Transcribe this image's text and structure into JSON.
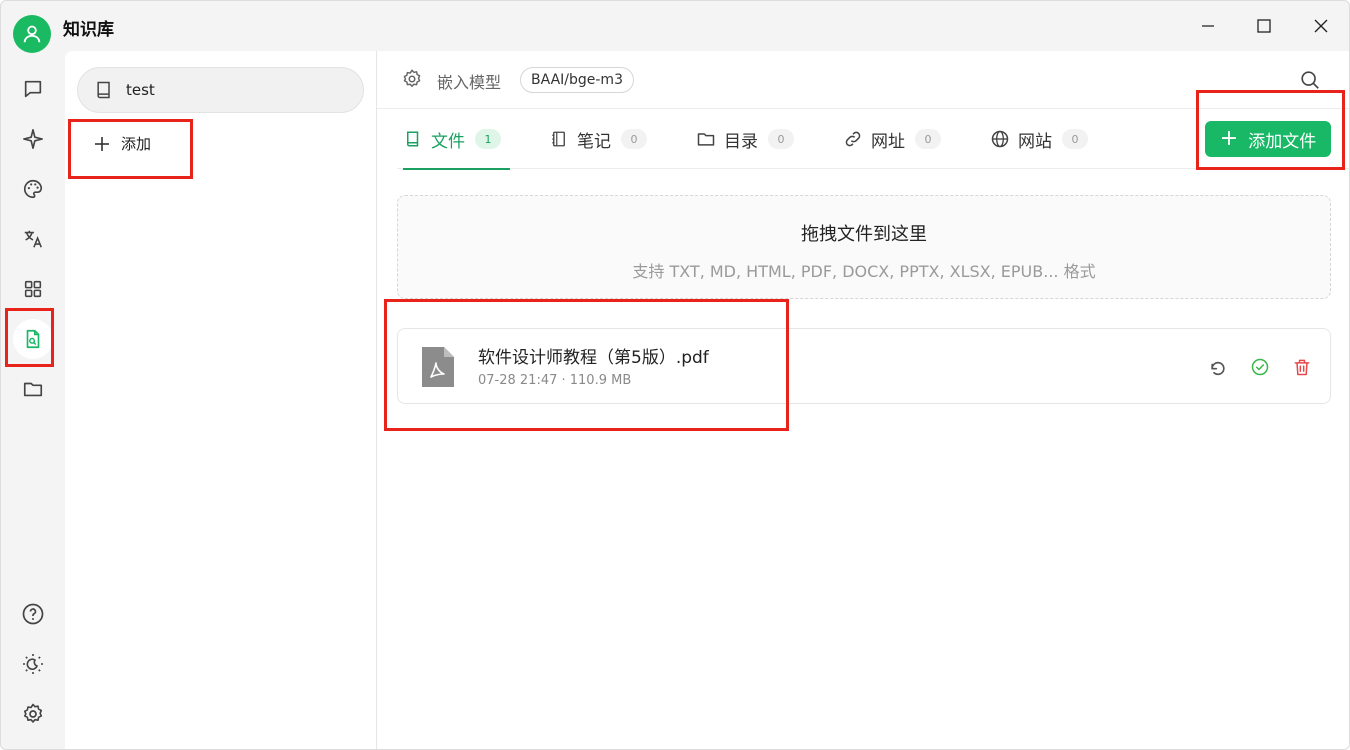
{
  "app": {
    "title": "知识库"
  },
  "window_controls": {
    "minimize": "minimize",
    "maximize": "maximize",
    "close": "close"
  },
  "rail": {
    "items": [
      {
        "icon": "chat-icon"
      },
      {
        "icon": "sparkle-icon"
      },
      {
        "icon": "palette-icon"
      },
      {
        "icon": "translate-icon"
      },
      {
        "icon": "apps-grid-icon"
      },
      {
        "icon": "knowledge-base-icon",
        "active": true
      },
      {
        "icon": "folder-icon"
      }
    ],
    "bottom": [
      {
        "icon": "help-icon"
      },
      {
        "icon": "theme-icon"
      },
      {
        "icon": "settings-icon"
      }
    ]
  },
  "kb_list": {
    "items": [
      {
        "label": "test"
      }
    ],
    "add_label": "添加"
  },
  "main": {
    "embed_label": "嵌入模型",
    "embed_model": "BAAI/bge-m3",
    "tabs": [
      {
        "label": "文件",
        "count": "1",
        "active": true
      },
      {
        "label": "笔记",
        "count": "0"
      },
      {
        "label": "目录",
        "count": "0"
      },
      {
        "label": "网址",
        "count": "0"
      },
      {
        "label": "网站",
        "count": "0"
      }
    ],
    "add_file_label": "添加文件",
    "dropzone": {
      "title": "拖拽文件到这里",
      "subtitle": "支持 TXT, MD, HTML, PDF, DOCX, PPTX, XLSX, EPUB... 格式"
    },
    "files": [
      {
        "name": "软件设计师教程（第5版）.pdf",
        "meta": "07-28 21:47 · 110.9 MB"
      }
    ]
  },
  "colors": {
    "accent": "#18b866",
    "highlight": "#e8231a",
    "delete": "#e5484d"
  }
}
